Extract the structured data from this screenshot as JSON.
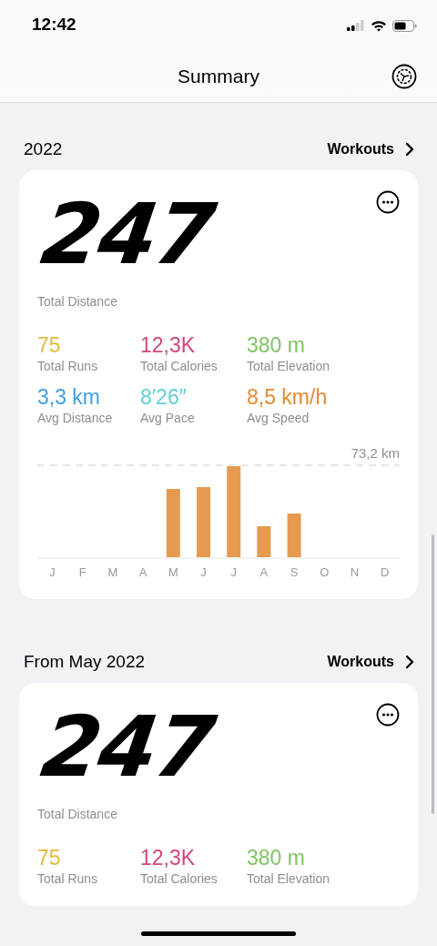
{
  "status_bar": {
    "time": "12:42"
  },
  "nav": {
    "title": "Summary"
  },
  "sections": [
    {
      "title": "2022",
      "link": "Workouts",
      "total": "247",
      "total_label": "Total Distance",
      "stats": [
        {
          "value": "75",
          "label": "Total Runs",
          "color": "#e4b93a"
        },
        {
          "value": "12,3K",
          "label": "Total Calories",
          "color": "#d6437a"
        },
        {
          "value": "380 m",
          "label": "Total Elevation",
          "color": "#7fc462"
        },
        {
          "value": "3,3 km",
          "label": "Avg Distance",
          "color": "#3f9fe4"
        },
        {
          "value": "8′26″",
          "label": "Avg Pace",
          "color": "#5fd0d4"
        },
        {
          "value": "8,5 km/h",
          "label": "Avg Speed",
          "color": "#e28a2e"
        }
      ],
      "chart": {
        "max_label": "73,2 km",
        "months": [
          "J",
          "F",
          "M",
          "A",
          "M",
          "J",
          "J",
          "A",
          "S",
          "O",
          "N",
          "D"
        ]
      }
    },
    {
      "title": "From May 2022",
      "link": "Workouts",
      "total": "247",
      "total_label": "Total Distance",
      "stats": [
        {
          "value": "75",
          "label": "Total Runs",
          "color": "#e4b93a"
        },
        {
          "value": "12,3K",
          "label": "Total Calories",
          "color": "#d6437a"
        },
        {
          "value": "380 m",
          "label": "Total Elevation",
          "color": "#7fc462"
        }
      ]
    }
  ]
}
